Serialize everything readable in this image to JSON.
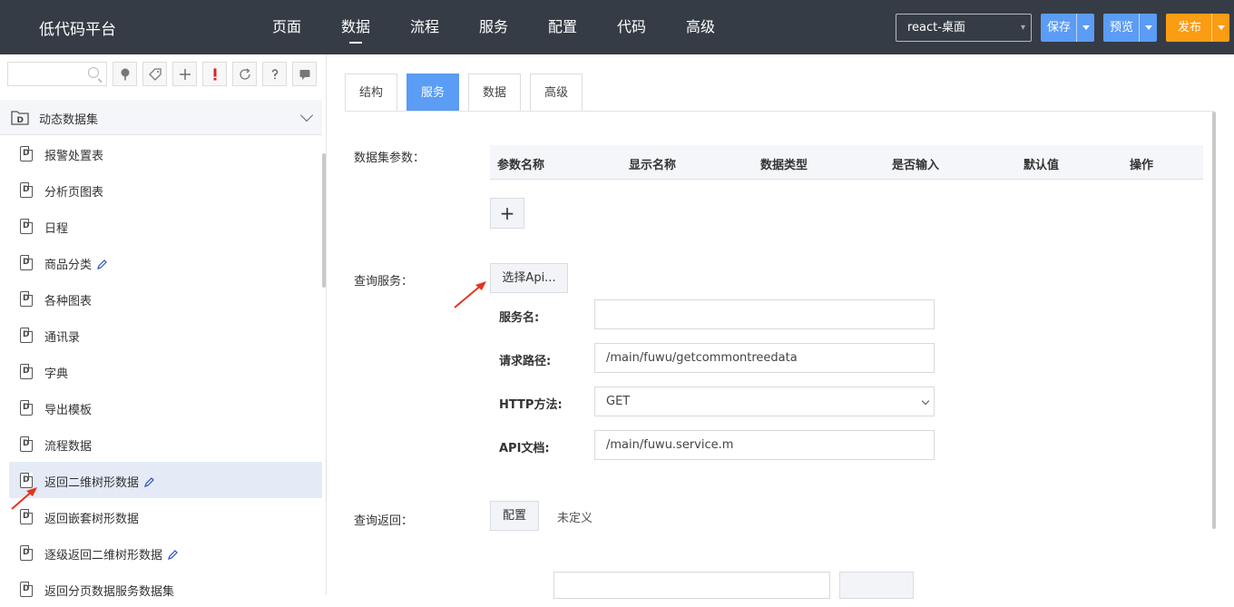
{
  "app": {
    "title": "低代码平台"
  },
  "nav": {
    "items": [
      {
        "label": "页面",
        "active": false
      },
      {
        "label": "数据",
        "active": true
      },
      {
        "label": "流程",
        "active": false
      },
      {
        "label": "服务",
        "active": false
      },
      {
        "label": "配置",
        "active": false
      },
      {
        "label": "代码",
        "active": false
      },
      {
        "label": "高级",
        "active": false
      }
    ]
  },
  "toolbar": {
    "env_select": "react-桌面",
    "save_label": "保存",
    "preview_label": "预览",
    "publish_label": "发布",
    "primary_color": "#5b9cf5",
    "publish_color": "#fa9c14"
  },
  "sidebar": {
    "search_value": "",
    "tools": [
      "tree-icon",
      "tag-icon",
      "plus-icon",
      "exclamation-icon",
      "refresh-icon",
      "help-icon",
      "comment-icon"
    ],
    "group": {
      "label": "动态数据集"
    },
    "items": [
      {
        "label": "报警处置表",
        "edited": false,
        "selected": false
      },
      {
        "label": "分析页图表",
        "edited": false,
        "selected": false
      },
      {
        "label": "日程",
        "edited": false,
        "selected": false
      },
      {
        "label": "商品分类",
        "edited": true,
        "selected": false
      },
      {
        "label": "各种图表",
        "edited": false,
        "selected": false
      },
      {
        "label": "通讯录",
        "edited": false,
        "selected": false
      },
      {
        "label": "字典",
        "edited": false,
        "selected": false
      },
      {
        "label": "导出模板",
        "edited": false,
        "selected": false
      },
      {
        "label": "流程数据",
        "edited": false,
        "selected": false
      },
      {
        "label": "返回二维树形数据",
        "edited": true,
        "selected": true
      },
      {
        "label": "返回嵌套树形数据",
        "edited": false,
        "selected": false
      },
      {
        "label": "逐级返回二维树形数据",
        "edited": true,
        "selected": false
      },
      {
        "label": "返回分页数据服务数据集",
        "edited": false,
        "selected": false
      }
    ]
  },
  "tabs": [
    {
      "label": "结构",
      "active": false
    },
    {
      "label": "服务",
      "active": true
    },
    {
      "label": "数据",
      "active": false
    },
    {
      "label": "高级",
      "active": false
    }
  ],
  "params": {
    "label": "数据集参数：",
    "columns": [
      "参数名称",
      "显示名称",
      "数据类型",
      "是否输入",
      "默认值",
      "操作"
    ],
    "add_label": "+"
  },
  "query_service": {
    "label": "查询服务：",
    "select_api_label": "选择Api...",
    "fields": {
      "service_name": {
        "label": "服务名:",
        "value": ""
      },
      "request_path": {
        "label": "请求路径:",
        "value": "/main/fuwu/getcommontreedata"
      },
      "http_method": {
        "label": "HTTP方法:",
        "value": "GET"
      },
      "api_doc": {
        "label": "API文档:",
        "value": "/main/fuwu.service.m"
      }
    }
  },
  "query_return": {
    "label": "查询返回：",
    "config_label": "配置",
    "status": "未定义"
  },
  "annotation_color": "#e8321e"
}
